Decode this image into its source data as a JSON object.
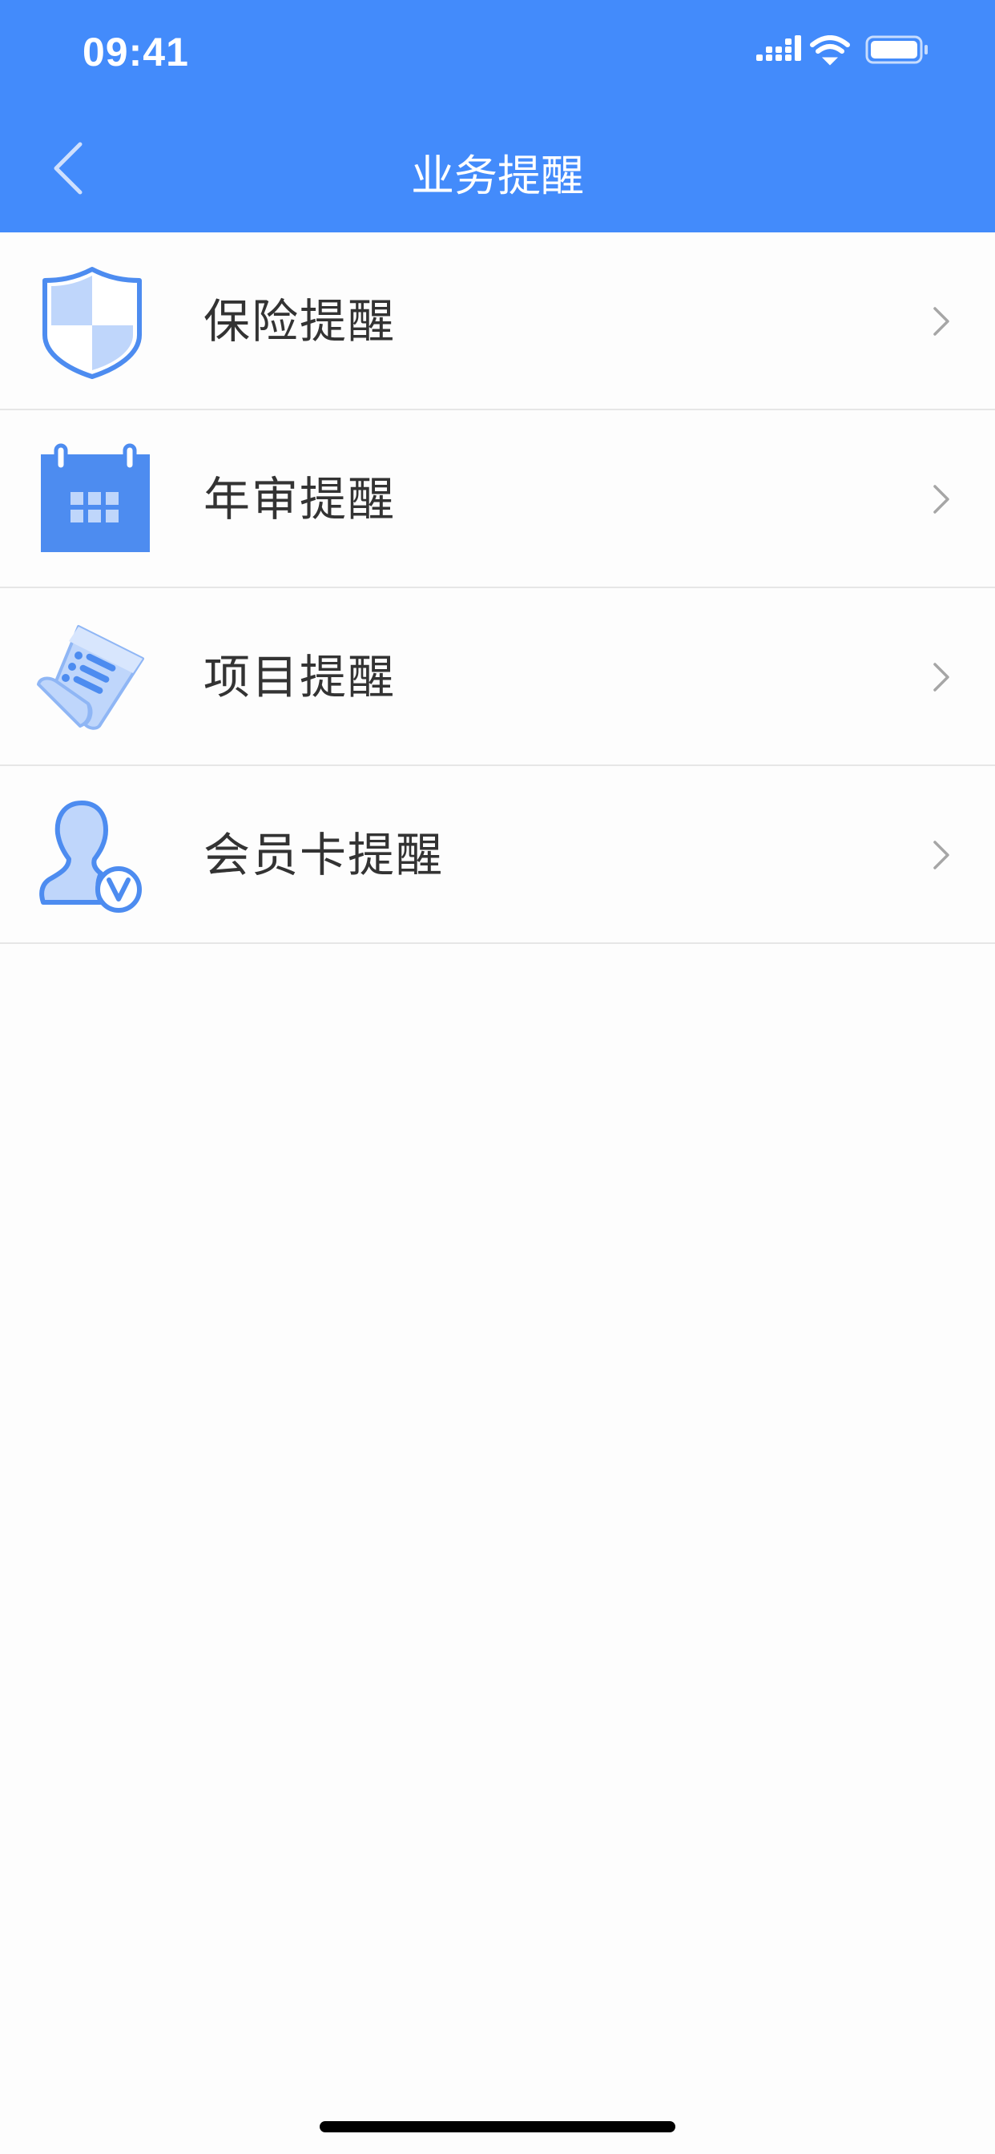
{
  "status_bar": {
    "time": "09:41",
    "icons": [
      "cellular-signal-icon",
      "wifi-icon",
      "battery-icon"
    ]
  },
  "nav": {
    "title": "业务提醒",
    "back_icon": "chevron-left-icon"
  },
  "items": [
    {
      "label": "保险提醒",
      "icon": "shield-icon"
    },
    {
      "label": "年审提醒",
      "icon": "calendar-icon"
    },
    {
      "label": "项目提醒",
      "icon": "document-list-icon"
    },
    {
      "label": "会员卡提醒",
      "icon": "member-user-icon"
    }
  ],
  "colors": {
    "header_bg": "#438bfb",
    "icon_primary": "#4d8cf0",
    "icon_light": "#bfd6fb",
    "text_primary": "#333333",
    "chevron": "#a6a6a6",
    "divider": "#e6e6e6"
  }
}
